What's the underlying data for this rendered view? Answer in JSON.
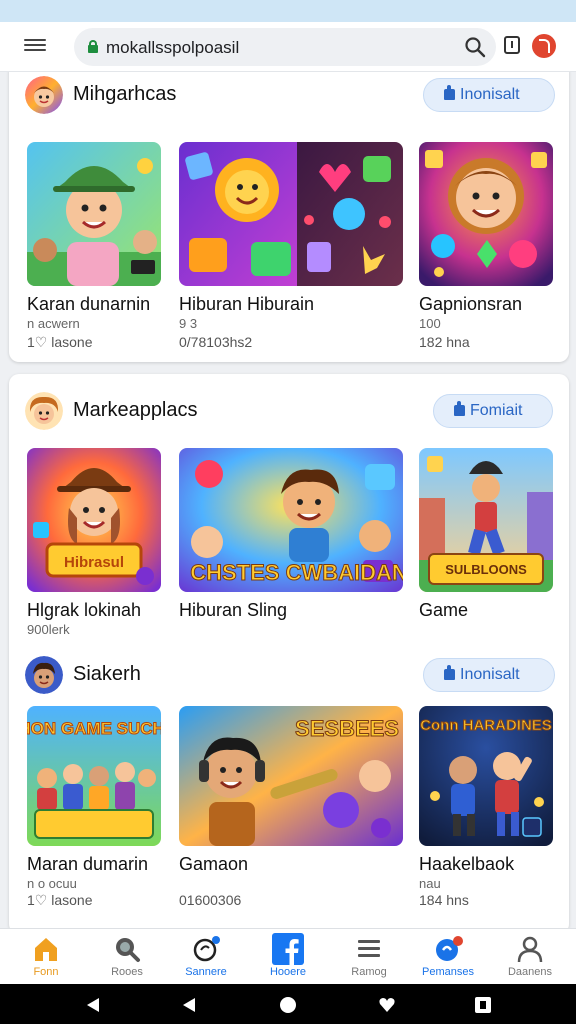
{
  "browser": {
    "url": "mokallsspolpoasil",
    "colors": {
      "secure": "#1e8e3e",
      "accent": "#2a66c4",
      "badge": "#e0452f"
    }
  },
  "sections": [
    {
      "title": "Mihgarhcas",
      "follow_label": "Inonisalt",
      "games": [
        {
          "title": "Karan dunarnin",
          "subtitle": "n acwern",
          "meta": "1♡ lasone"
        },
        {
          "title": "Hiburan Hiburain",
          "subtitle": "9 3",
          "meta": "0/78103hs2"
        },
        {
          "title": "Gapnionsran",
          "subtitle": "100",
          "meta": "182 hna"
        }
      ]
    },
    {
      "title": "Markeapplacs",
      "follow_label": "Fomiait",
      "games": [
        {
          "title": "Hlgrak lokinah",
          "subtitle": "900lerk",
          "meta": "",
          "art": "Hibrasul"
        },
        {
          "title": "Hiburan Sling",
          "subtitle": "",
          "meta": "",
          "art": "CHSTES CWBAIDAN"
        },
        {
          "title": "Game",
          "subtitle": "",
          "meta": "",
          "art": "SULBLOONS"
        }
      ]
    },
    {
      "title": "Siakerh",
      "follow_label": "Inonisalt",
      "games": [
        {
          "title": "Maran dumarin",
          "subtitle": "n o ocuu",
          "meta": "1♡ lasone",
          "art": "BHERHON GAME SUCHPUKIN"
        },
        {
          "title": "Gamaon",
          "subtitle": "",
          "meta": "01600306",
          "art": "SESBEES"
        },
        {
          "title": "Haakelbaok",
          "subtitle": "nau",
          "meta": "184 hns",
          "art": "Conn HARADINES"
        }
      ]
    }
  ],
  "bottom_nav": [
    {
      "label": "Fonn",
      "icon": "home-icon"
    },
    {
      "label": "Rooes",
      "icon": "search-icon"
    },
    {
      "label": "Sannere",
      "icon": "refresh-icon"
    },
    {
      "label": "Hooere",
      "icon": "facebook-icon"
    },
    {
      "label": "Ramog",
      "icon": "list-icon"
    },
    {
      "label": "Pemanses",
      "icon": "notification-icon"
    },
    {
      "label": "Daanens",
      "icon": "person-icon"
    }
  ]
}
